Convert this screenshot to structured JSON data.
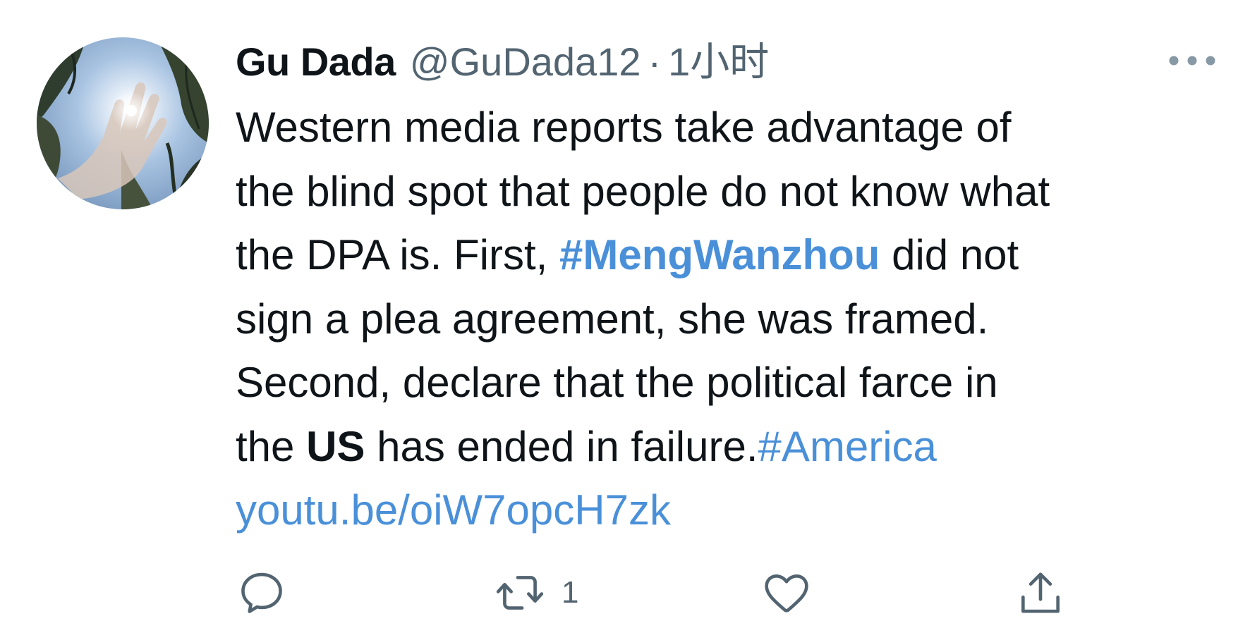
{
  "tweet": {
    "author": {
      "display_name": "Gu Dada",
      "handle": "@GuDada12",
      "separator": "·",
      "timestamp": "1小时"
    },
    "text": {
      "l1": "Western media reports take advantage of",
      "l2": "the blind spot that people do not know what",
      "l3_pre": "the DPA is. First, ",
      "l3_tag": "#MengWanzhou",
      "l3_post": " did not",
      "l4": "sign a plea agreement, she was framed.",
      "l5": "Second, declare that the political farce in",
      "l6_pre": "the ",
      "l6_bold": "US",
      "l6_mid": " has ended in failure.",
      "l6_tag": "#America",
      "l7_link": "youtu.be/oiW7opcH7zk"
    },
    "actions": {
      "reply_count": "",
      "retweet_count": "1",
      "like_count": "",
      "icons": [
        "reply-icon",
        "retweet-icon",
        "like-icon",
        "share-icon",
        "more-icon"
      ]
    },
    "colors": {
      "text": "#0f1419",
      "secondary": "#536471",
      "link": "#4a90d9",
      "icon": "#536471"
    }
  }
}
